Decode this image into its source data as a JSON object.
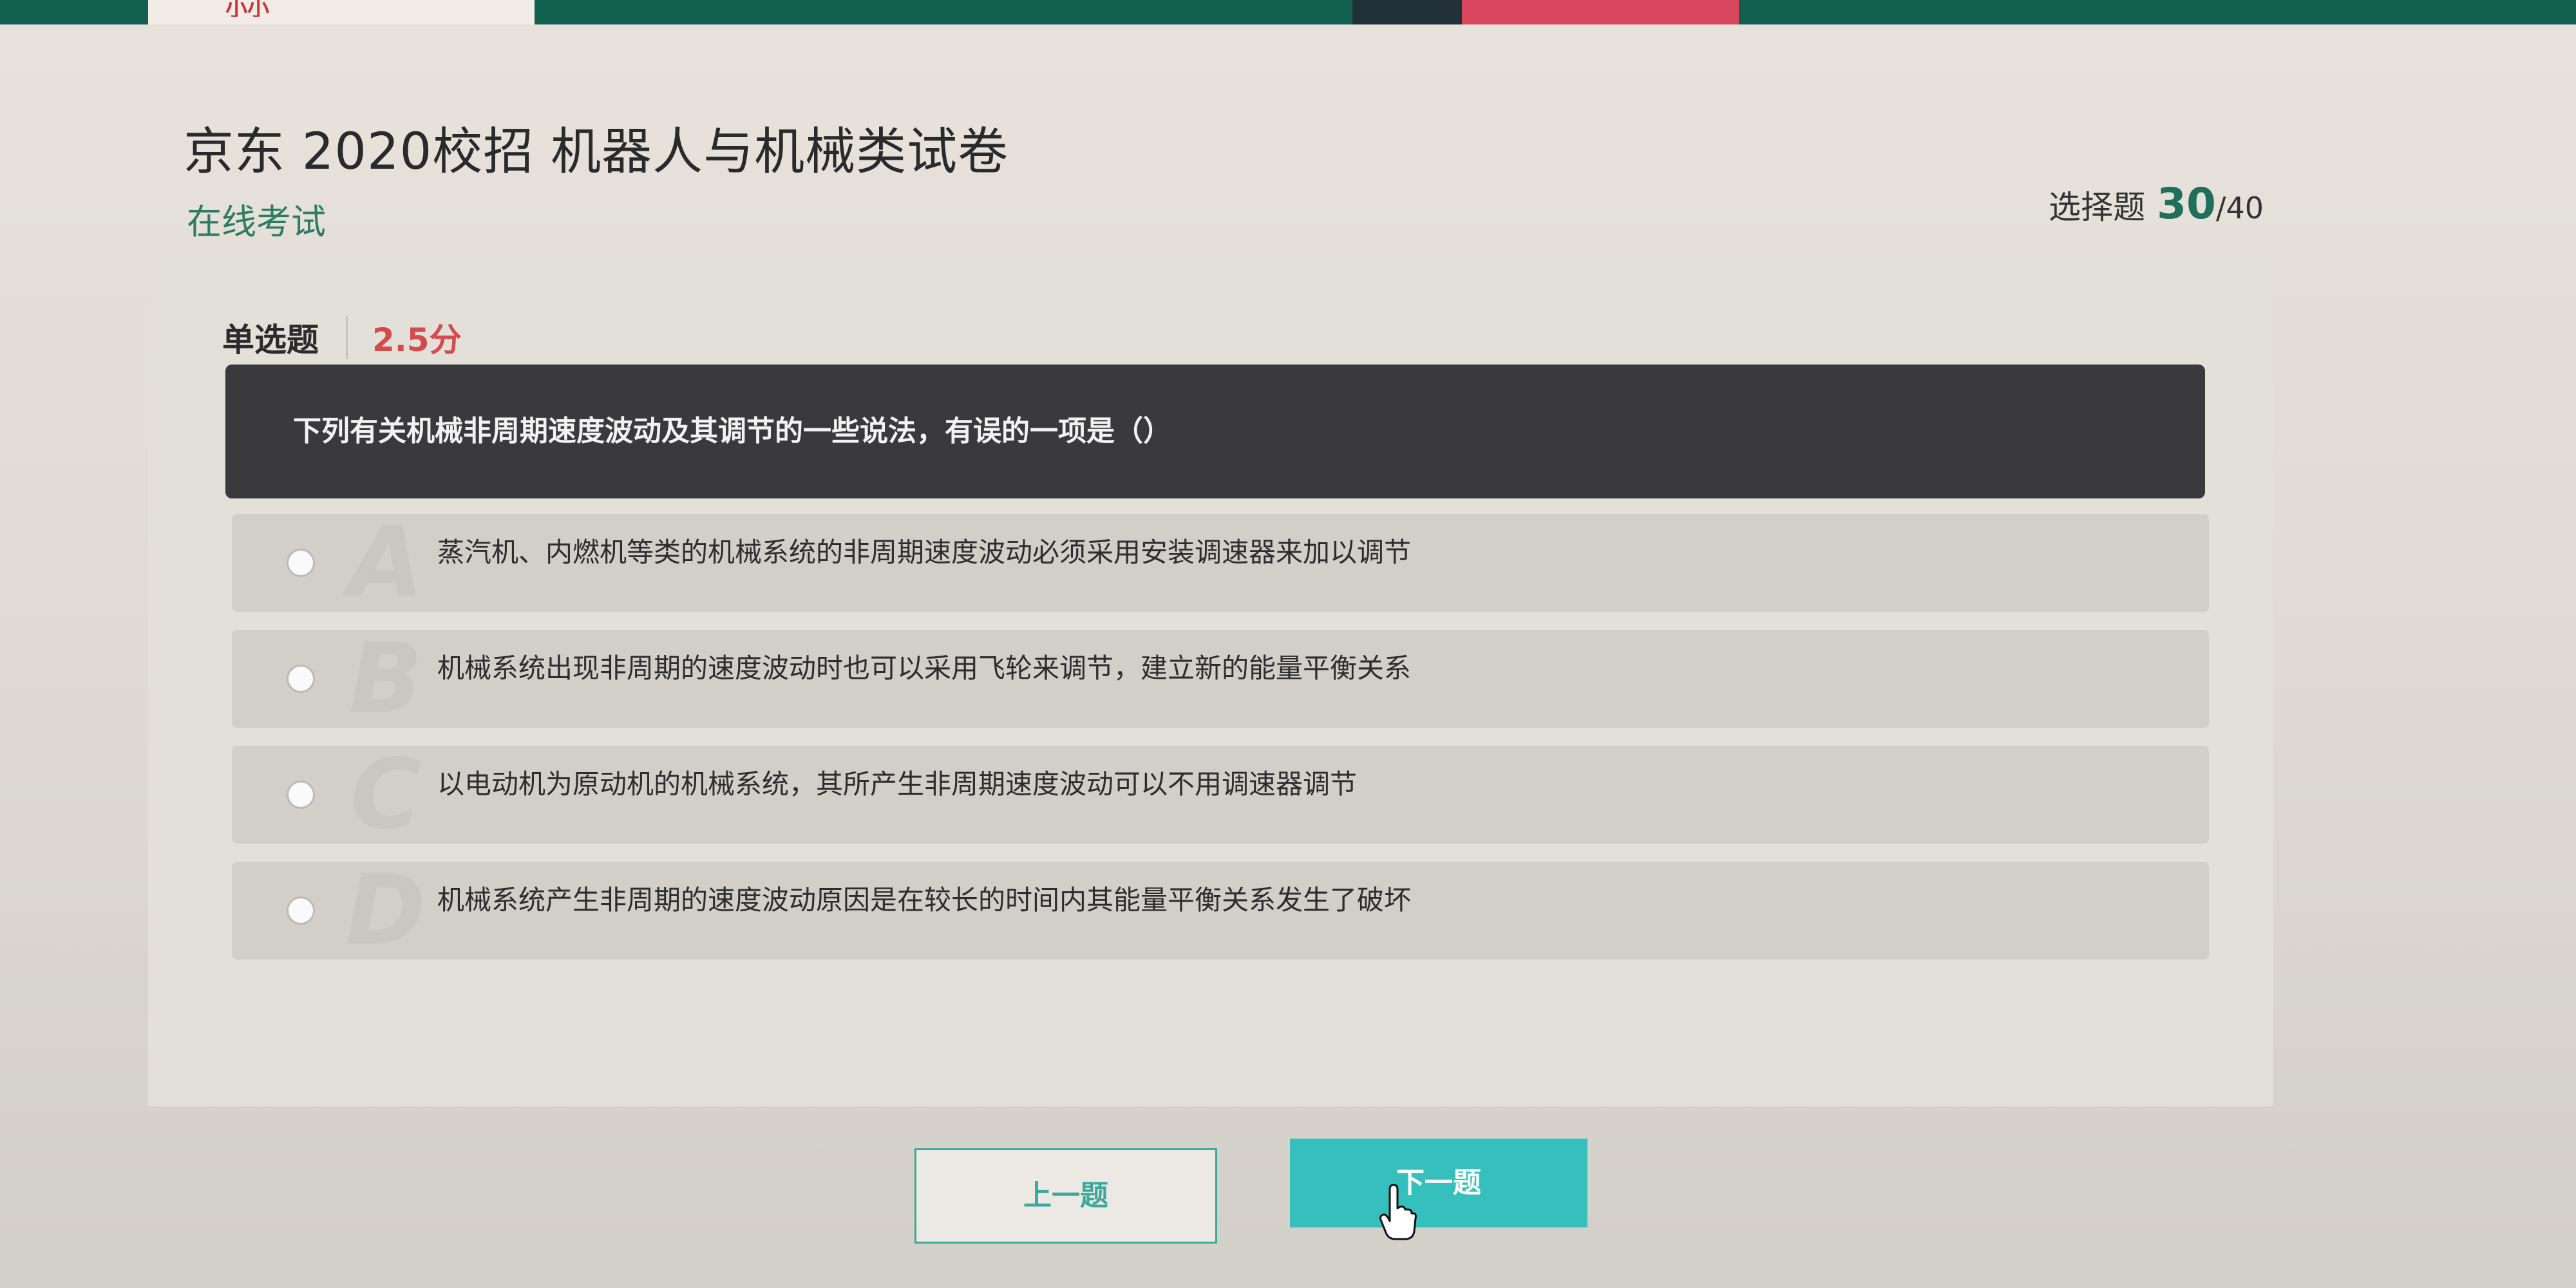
{
  "topbar": {
    "logo_text": "小小"
  },
  "header": {
    "title": "京东 2020校招 机器人与机械类试卷",
    "subtitle": "在线考试",
    "progress_label": "选择题",
    "progress_current": "30",
    "progress_total": "/40"
  },
  "question": {
    "type_label": "单选题",
    "score": "2.5分",
    "text": "下列有关机械非周期速度波动及其调节的一些说法，有误的一项是（）",
    "options": [
      {
        "letter": "A",
        "text": "蒸汽机、内燃机等类的机械系统的非周期速度波动必须采用安装调速器来加以调节"
      },
      {
        "letter": "B",
        "text": "机械系统出现非周期的速度波动时也可以采用飞轮来调节，建立新的能量平衡关系"
      },
      {
        "letter": "C",
        "text": "以电动机为原动机的机械系统，其所产生非周期速度波动可以不用调速器调节"
      },
      {
        "letter": "D",
        "text": "机械系统产生非周期的速度波动原因是在较长的时间内其能量平衡关系发生了破坏"
      }
    ]
  },
  "nav": {
    "prev_label": "上一题",
    "next_label": "下一题"
  },
  "colors": {
    "accent": "#36c0bd",
    "brand_green": "#2e7b62",
    "score_red": "#d34b4b",
    "question_bg": "#3a393b"
  }
}
